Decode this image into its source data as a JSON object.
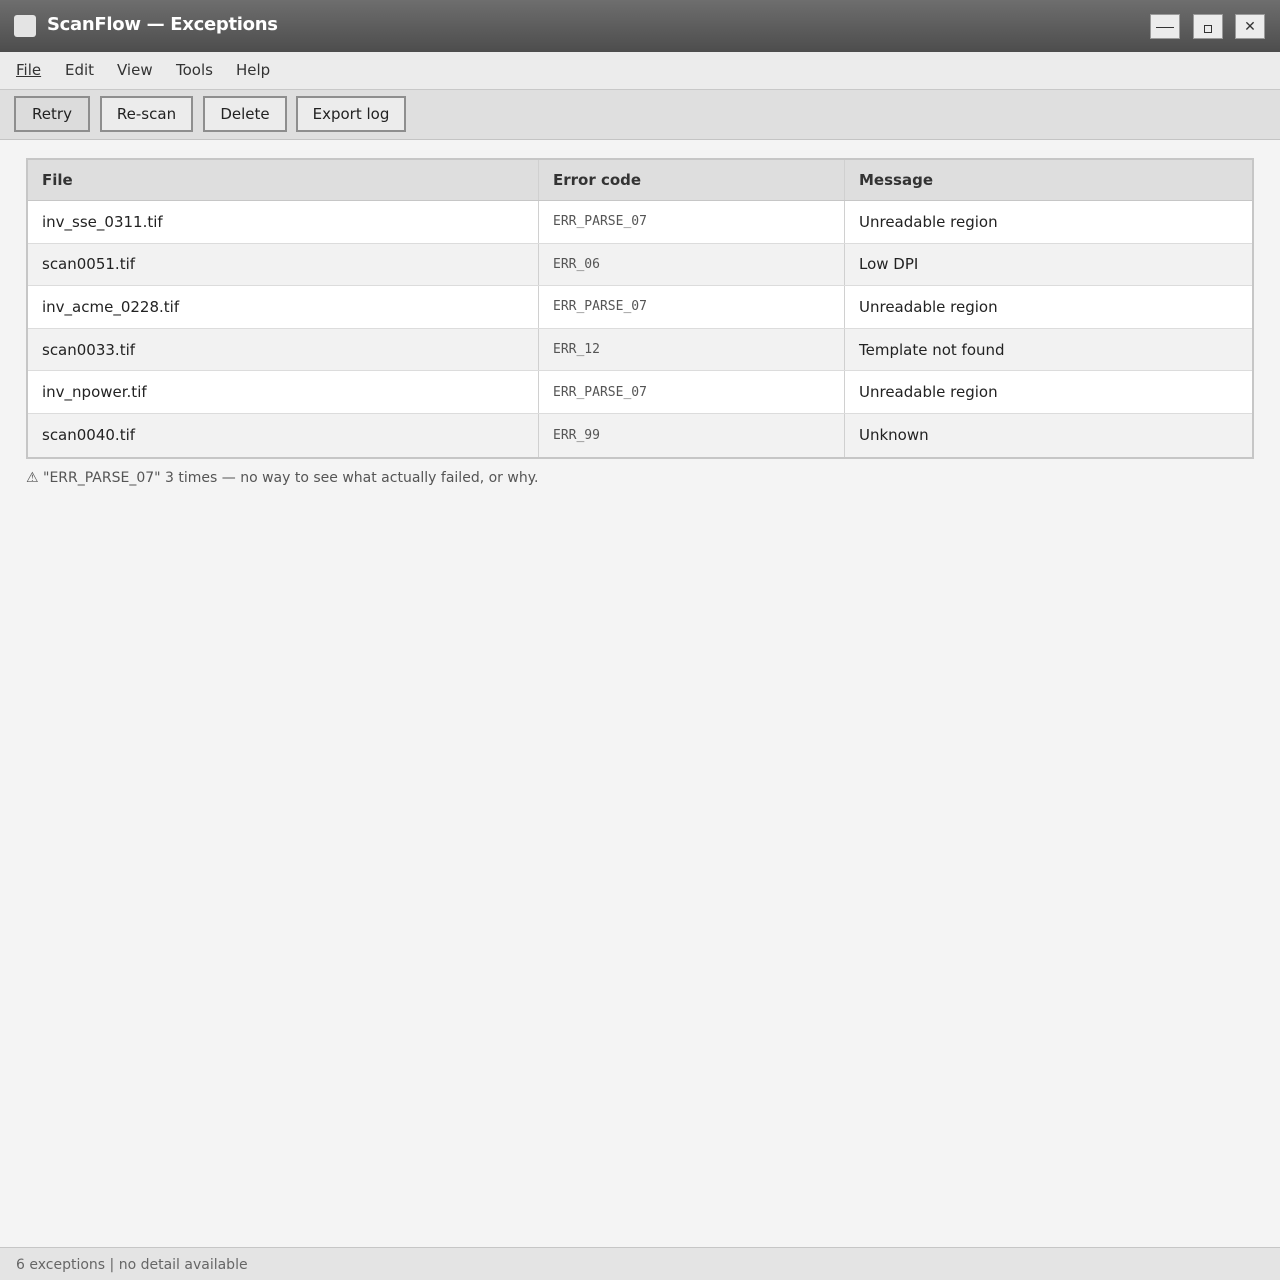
{
  "window": {
    "title": "ScanFlow — Exceptions",
    "icons": {
      "app": "app-icon",
      "minimize": "minimize-icon",
      "maximize": "maximize-icon",
      "close": "close-icon"
    },
    "close_glyph": "✕"
  },
  "menu": {
    "items": [
      "File",
      "Edit",
      "View",
      "Tools",
      "Help"
    ]
  },
  "toolbar": {
    "retry_label": "Retry",
    "rescan_label": "Re-scan",
    "delete_label": "Delete",
    "export_label": "Export log"
  },
  "table": {
    "columns": [
      "File",
      "Error code",
      "Message"
    ],
    "rows": [
      {
        "file": "inv_sse_0311.tif",
        "code": "ERR_PARSE_07",
        "message": "Unreadable region"
      },
      {
        "file": "scan0051.tif",
        "code": "ERR_06",
        "message": "Low DPI"
      },
      {
        "file": "inv_acme_0228.tif",
        "code": "ERR_PARSE_07",
        "message": "Unreadable region"
      },
      {
        "file": "scan0033.tif",
        "code": "ERR_12",
        "message": "Template not found"
      },
      {
        "file": "inv_npower.tif",
        "code": "ERR_PARSE_07",
        "message": "Unreadable region"
      },
      {
        "file": "scan0040.tif",
        "code": "ERR_99",
        "message": "Unknown"
      }
    ]
  },
  "note": {
    "text": "⚠ \"ERR_PARSE_07\" 3 times — no way to see what actually failed, or why."
  },
  "status": {
    "text": "6 exceptions | no detail available"
  }
}
